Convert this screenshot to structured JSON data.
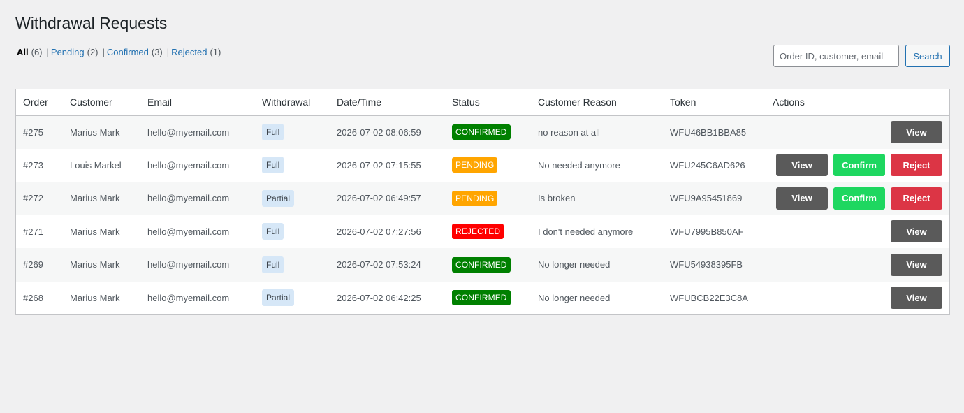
{
  "title": "Withdrawal Requests",
  "filters": [
    {
      "label": "All",
      "count": "(6)"
    },
    {
      "label": "Pending",
      "count": "(2)"
    },
    {
      "label": "Confirmed",
      "count": "(3)"
    },
    {
      "label": "Rejected",
      "count": "(1)"
    }
  ],
  "search": {
    "placeholder": "Order ID, customer, email",
    "button_label": "Search"
  },
  "columns": [
    "Order",
    "Customer",
    "Email",
    "Withdrawal",
    "Date/Time",
    "Status",
    "Customer Reason",
    "Token",
    "Actions"
  ],
  "status_colors": {
    "CONFIRMED": "#008000",
    "PENDING": "#ffa500",
    "REJECTED": "#ff0000"
  },
  "action_labels": {
    "view": "View",
    "confirm": "Confirm",
    "reject": "Reject"
  },
  "rows": [
    {
      "order": "#275",
      "customer": "Marius Mark",
      "email": "hello@myemail.com",
      "withdrawal": "Full",
      "datetime": "2026-07-02 08:06:59",
      "status": "CONFIRMED",
      "reason": "no reason at all",
      "token": "WFU46BB1BBA85"
    },
    {
      "order": "#273",
      "customer": "Louis Markel",
      "email": "hello@myemail.com",
      "withdrawal": "Full",
      "datetime": "2026-07-02 07:15:55",
      "status": "PENDING",
      "reason": "No needed anymore",
      "token": "WFU245C6AD626"
    },
    {
      "order": "#272",
      "customer": "Marius Mark",
      "email": "hello@myemail.com",
      "withdrawal": "Partial",
      "datetime": "2026-07-02 06:49:57",
      "status": "PENDING",
      "reason": "Is broken",
      "token": "WFU9A95451869"
    },
    {
      "order": "#271",
      "customer": "Marius Mark",
      "email": "hello@myemail.com",
      "withdrawal": "Full",
      "datetime": "2026-07-02 07:27:56",
      "status": "REJECTED",
      "reason": "I don't needed anymore",
      "token": "WFU7995B850AF"
    },
    {
      "order": "#269",
      "customer": "Marius Mark",
      "email": "hello@myemail.com",
      "withdrawal": "Full",
      "datetime": "2026-07-02 07:53:24",
      "status": "CONFIRMED",
      "reason": "No longer needed",
      "token": "WFU54938395FB"
    },
    {
      "order": "#268",
      "customer": "Marius Mark",
      "email": "hello@myemail.com",
      "withdrawal": "Partial",
      "datetime": "2026-07-02 06:42:25",
      "status": "CONFIRMED",
      "reason": "No longer needed",
      "token": "WFUBCB22E3C8A"
    }
  ]
}
